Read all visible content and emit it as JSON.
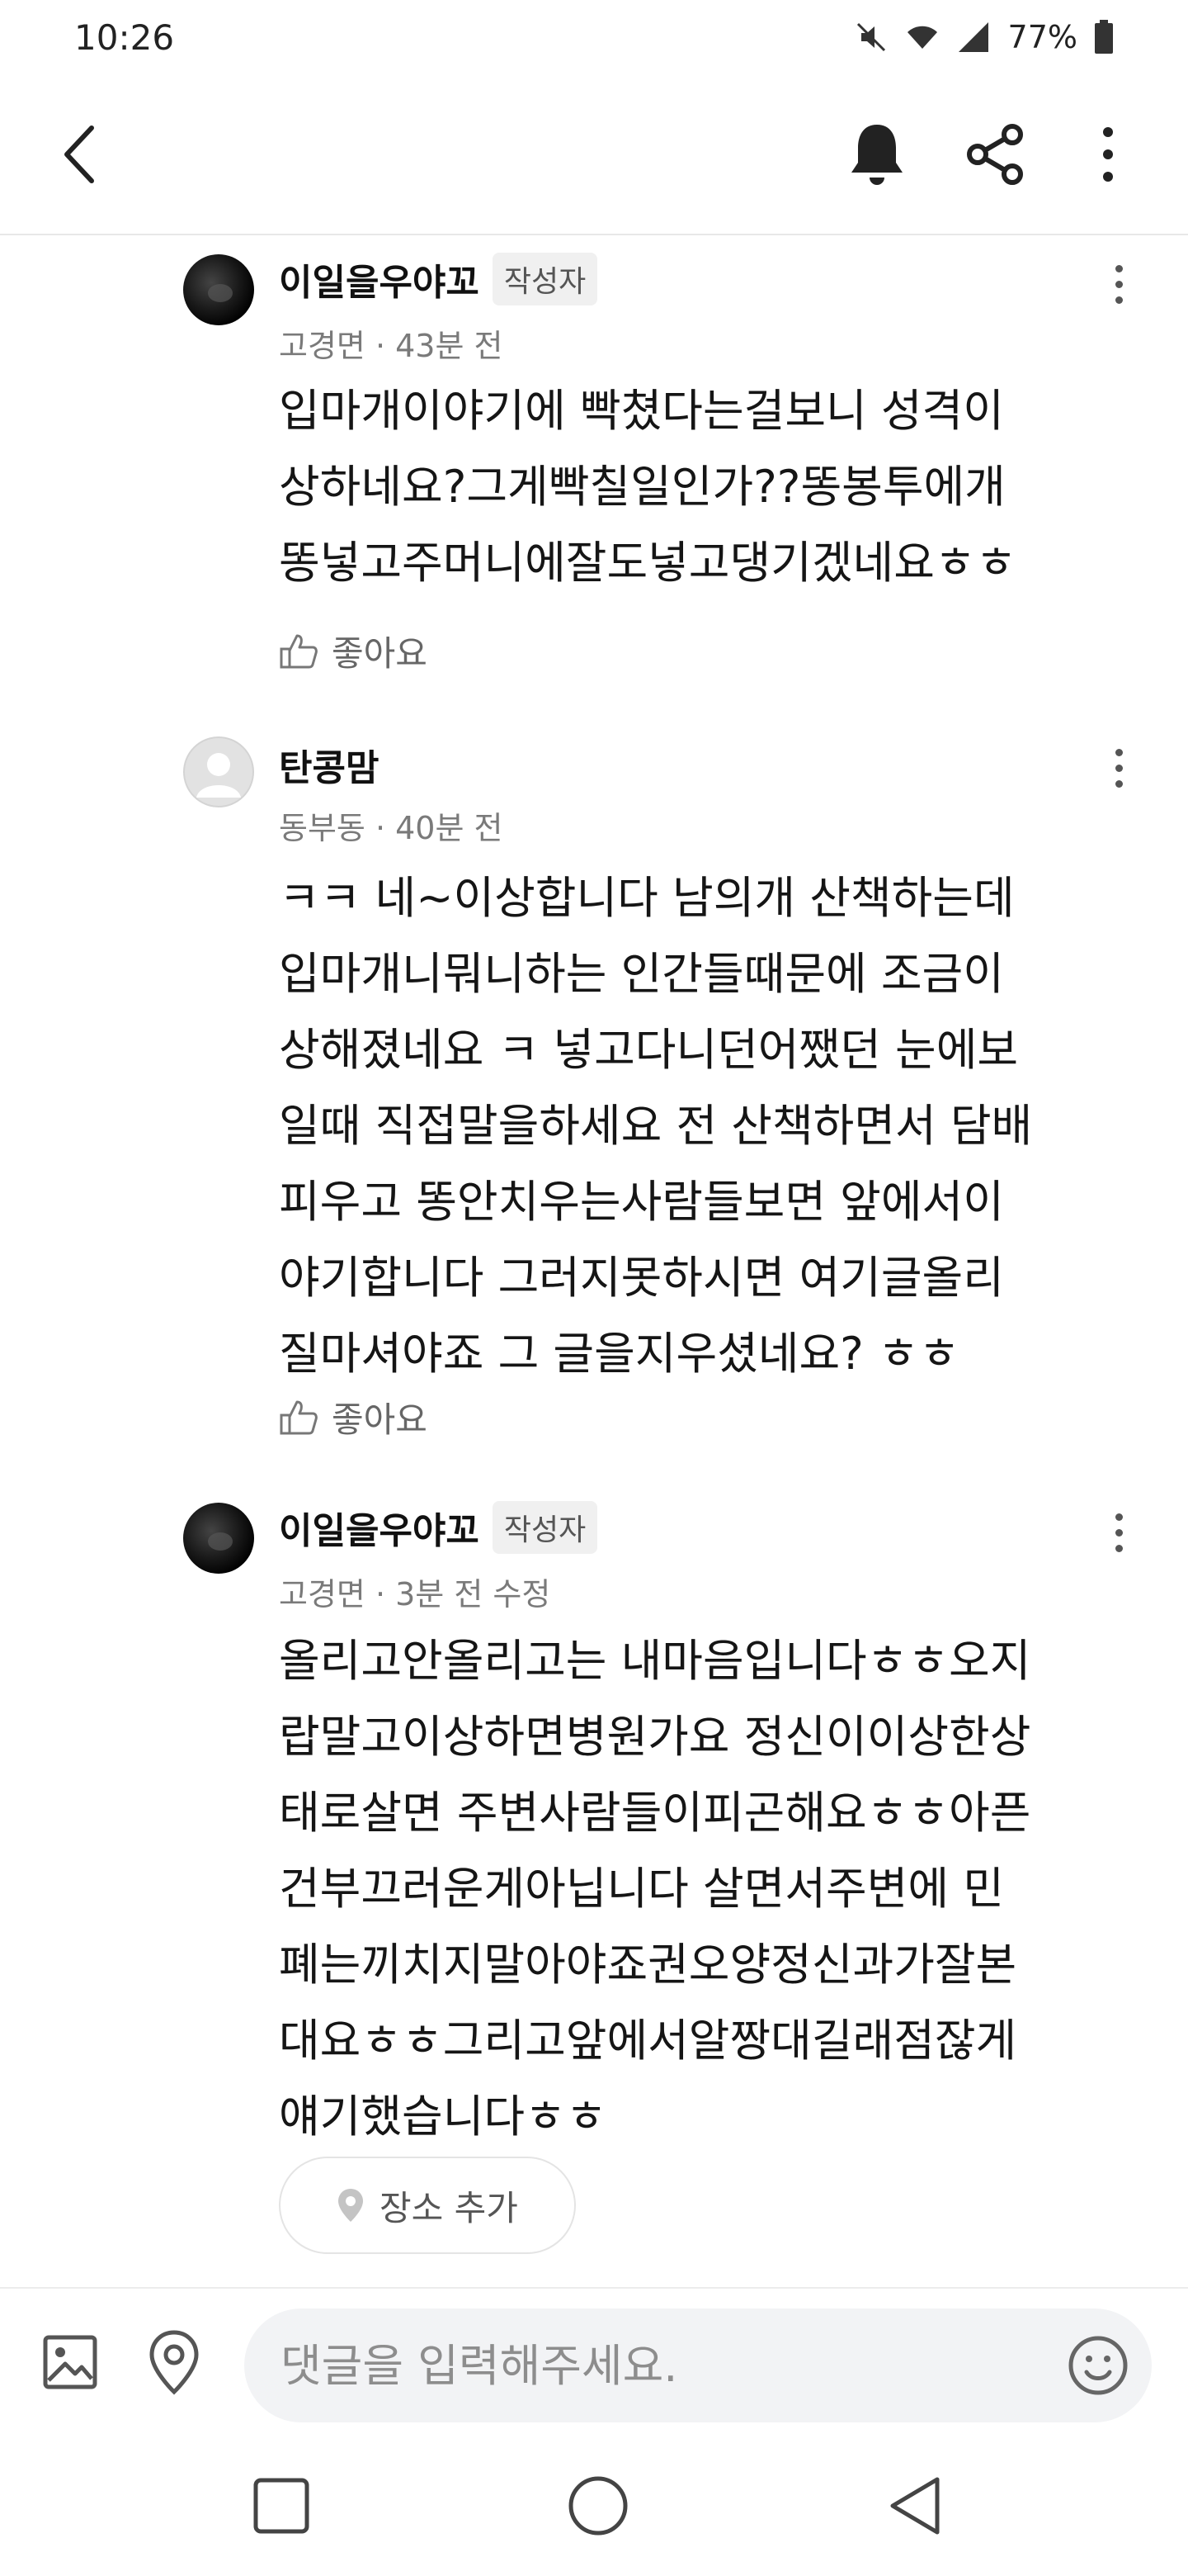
{
  "status_bar": {
    "time": "10:26",
    "battery": "77%"
  },
  "header": {
    "back_icon": "chevron-left-icon",
    "bell_icon": "bell-icon",
    "share_icon": "share-icon",
    "more_icon": "more-vertical-icon"
  },
  "comments": [
    {
      "author": "이일을우야꼬",
      "badge": "작성자",
      "meta": "고경면 · 43분 전",
      "text": "입마개이야기에 빡쳤다는걸보니 성격이\n상하네요?그게빡칠일인가??똥봉투에개\n똥넣고주머니에잘도넣고댕기겠네요ㅎㅎ",
      "like_label": "좋아요"
    },
    {
      "author": "탄콩맘",
      "badge": "",
      "meta": "동부동 · 40분 전",
      "text": "ㅋㅋ 네~이상합니다 남의개 산책하는데\n입마개니뭐니하는 인간들때문에 조금이\n상해졌네요 ㅋ 넣고다니던어쨌던 눈에보\n일때 직접말을하세요 전 산책하면서 담배\n피우고 똥안치우는사람들보면 앞에서이\n야기합니다 그러지못하시면 여기글올리\n질마셔야죠 그 글을지우셨네요? ㅎㅎ",
      "like_label": "좋아요"
    },
    {
      "author": "이일을우야꼬",
      "badge": "작성자",
      "meta": "고경면 · 3분 전 수정",
      "text": "올리고안올리고는 내마음입니다ㅎㅎ오지\n랍말고이상하면병원가요 정신이이상한상\n태로살면 주변사람들이피곤해요ㅎㅎ아픈\n건부끄러운게아닙니다 살면서주변에 민\n폐는끼치지말아야죠권오양정신과가잘본\n대요ㅎㅎ그리고앞에서알짱대길래점잖게\n얘기했습니다ㅎㅎ",
      "place_label": "장소 추가"
    }
  ],
  "input_bar": {
    "placeholder": "댓글을 입력해주세요.",
    "image_icon": "image-icon",
    "location_icon": "location-pin-icon",
    "emoji_icon": "emoji-icon"
  },
  "nav_bar": {
    "recents_icon": "square-icon",
    "home_icon": "circle-icon",
    "back_icon": "triangle-back-icon"
  }
}
